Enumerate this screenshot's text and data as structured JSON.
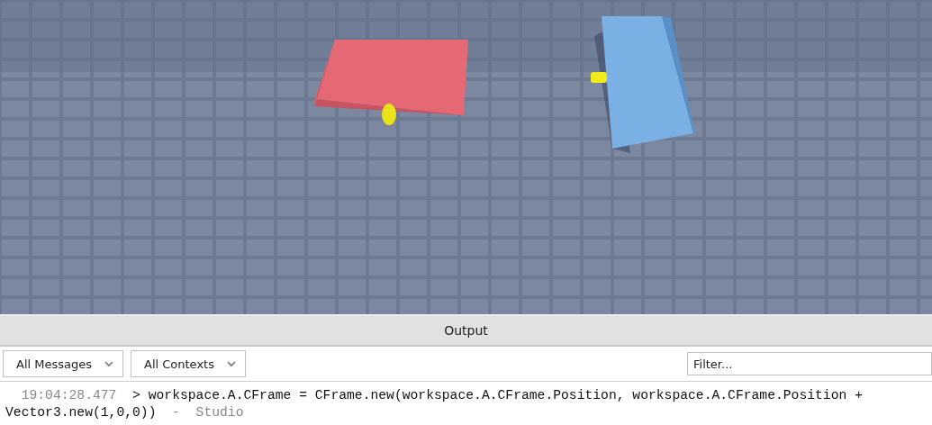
{
  "output": {
    "title": "Output",
    "filters": [
      {
        "label": "All Messages"
      },
      {
        "label": "All Contexts"
      }
    ],
    "search": {
      "placeholder": "Filter..."
    },
    "entries": [
      {
        "time": "19:04:28.477",
        "message": "> workspace.A.CFrame = CFrame.new(workspace.A.CFrame.Position, workspace.A.CFrame.Position + Vector3.new(1,0,0))",
        "separator": "-",
        "source": "Studio"
      }
    ]
  }
}
